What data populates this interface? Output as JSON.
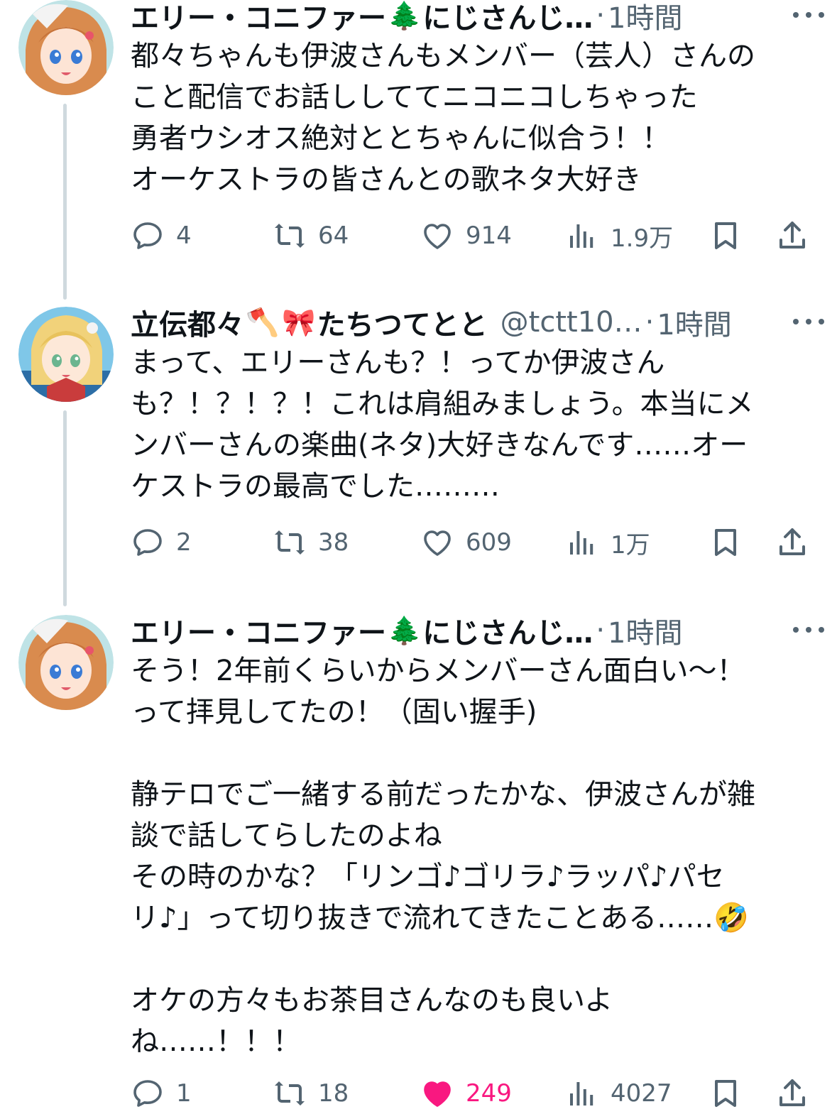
{
  "tweets": [
    {
      "name": "エリー・コニファー",
      "name_emoji": "🌲",
      "name_suffix": "にじさんじ…",
      "dot": "·",
      "time": "1時間",
      "lines": [
        "都々ちゃんも伊波さんもメンバー（芸人）さんの",
        "こと配信でお話ししててニコニコしちゃった",
        "勇者ウシオス絶対ととちゃんに似合う！！",
        "オーケストラの皆さんとの歌ネタ大好き"
      ],
      "replies": "4",
      "retweets": "64",
      "likes": "914",
      "views": "1.9万"
    },
    {
      "name": "立伝都々",
      "name_emoji": "🪓",
      "name_emoji2": "🎀",
      "name_suffix": "たちつてとと",
      "handle": "@tctt10…",
      "dot": "·",
      "time": "1時間",
      "lines": [
        "まって、エリーさんも？！ってか伊波さん",
        "も？！？！？！これは肩組みましょう。本当にメ",
        "ンバーさんの楽曲(ネタ)大好きなんです……オー",
        "ケストラの最高でした………"
      ],
      "replies": "2",
      "retweets": "38",
      "likes": "609",
      "views": "1万"
    },
    {
      "name": "エリー・コニファー",
      "name_emoji": "🌲",
      "name_suffix": "にじさんじ…",
      "dot": "·",
      "time": "1時間",
      "lines": [
        "そう！2年前くらいからメンバーさん面白い〜！",
        "って拝見してたの！（固い握手)",
        "",
        "静テロでご一緒する前だったかな、伊波さんが雑",
        "談で話してらしたのよね",
        "その時のかな？「リンゴ♪ゴリラ♪ラッパ♪パセ",
        "リ♪」って切り抜きで流れてきたことある……🤣",
        "",
        "オケの方々もお茶目さんなのも良いよ",
        "ね……！！！"
      ],
      "replies": "1",
      "retweets": "18",
      "likes": "249",
      "views": "4027"
    }
  ],
  "colors": {
    "text": "#0f1419",
    "secondary": "#536471",
    "like_active": "#f91880",
    "thread_line": "#cfd9de"
  },
  "icons": {
    "reply": "reply-icon",
    "retweet": "retweet-icon",
    "like": "heart-icon",
    "views": "views-icon",
    "bookmark": "bookmark-icon",
    "share": "share-icon",
    "more": "more-icon"
  }
}
